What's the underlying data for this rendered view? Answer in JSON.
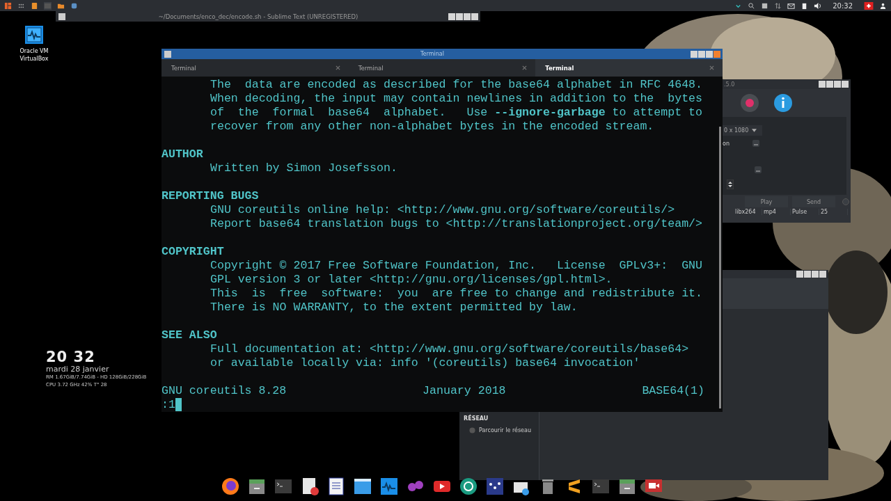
{
  "top_panel": {
    "clock": "20:32"
  },
  "desktop_icons": [
    {
      "label": "Oracle VM VirtualBox"
    }
  ],
  "clock_widget": {
    "time": "20 32",
    "date": "mardi 28 janvier",
    "memory": "RM 1.67GiB/7.74GiB - HD 128GiB/228GiB",
    "cpu": "CPU 3.72 GHz 42% T° 28"
  },
  "sublime_window": {
    "title": "~/Documents/enco_dec/encode.sh - Sublime Text (UNREGISTERED)"
  },
  "recorder_window": {
    "title": ".5.0",
    "resolution": "0 x 1080",
    "option_label": "on",
    "buttons": [
      "Play",
      "Send"
    ],
    "status": [
      "libx264",
      "mp4",
      "Pulse",
      "25"
    ]
  },
  "file_manager": {
    "section": "RÉSEAU",
    "items": [
      {
        "label": "Parcourir le réseau"
      }
    ]
  },
  "terminal": {
    "title": "Terminal",
    "tabs": [
      {
        "label": "Terminal",
        "selected": false
      },
      {
        "label": "Terminal",
        "selected": false
      },
      {
        "label": "Terminal",
        "selected": true
      }
    ],
    "sections": [
      {
        "lines": [
          "The  data are encoded as described for the base64 alphabet in RFC 4648.",
          "When decoding, the input may contain newlines in addition to the  bytes",
          "of  the  formal  base64  alphabet.   Use **--ignore-garbage** to attempt to",
          "recover from any other non-alphabet bytes in the encoded stream."
        ]
      },
      {
        "heading": "AUTHOR",
        "lines": [
          "Written by Simon Josefsson."
        ]
      },
      {
        "heading": "REPORTING BUGS",
        "lines": [
          "GNU coreutils online help: <http://www.gnu.org/software/coreutils/>",
          "Report base64 translation bugs to <http://translationproject.org/team/>"
        ]
      },
      {
        "heading": "COPYRIGHT",
        "lines": [
          "Copyright © 2017 Free Software Foundation, Inc.   License  GPLv3+:  GNU",
          "GPL version 3 or later <http://gnu.org/licenses/gpl.html>.",
          "This  is  free  software:  you  are free to change and redistribute it.",
          "There is NO WARRANTY, to the extent permitted by law."
        ]
      },
      {
        "heading": "SEE ALSO",
        "lines": [
          "Full documentation at: <http://www.gnu.org/software/coreutils/base64>",
          "or available locally via: info '(coreutils) base64 invocation'"
        ]
      }
    ],
    "footer": {
      "left": "GNU coreutils 8.28",
      "center": "January 2018",
      "right": "BASE64(1)"
    },
    "prompt": ":1"
  }
}
